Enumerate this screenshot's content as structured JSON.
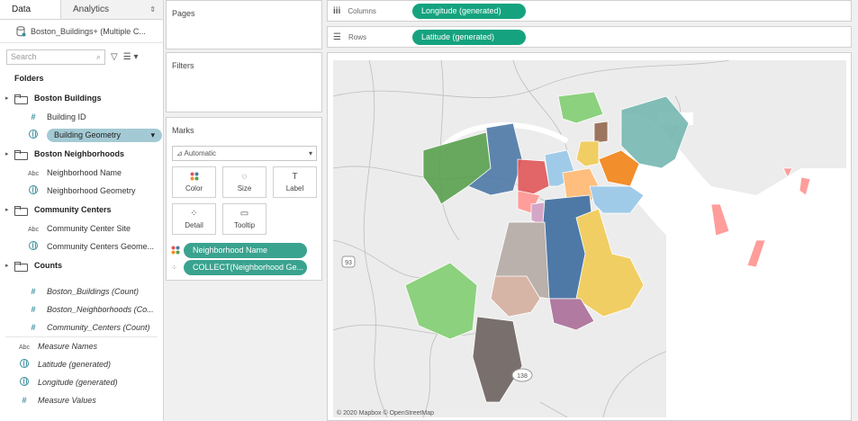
{
  "tabs": {
    "data": "Data",
    "analytics": "Analytics"
  },
  "datasource": "Boston_Buildings+ (Multiple C...",
  "search": {
    "placeholder": "Search"
  },
  "folders_label": "Folders",
  "folders": [
    {
      "name": "Boston Buildings",
      "fields": [
        {
          "type": "hash",
          "name": "Building ID"
        },
        {
          "type": "globe",
          "name": "Building Geometry",
          "selected": true
        }
      ]
    },
    {
      "name": "Boston Neighborhoods",
      "fields": [
        {
          "type": "abc",
          "name": "Neighborhood Name"
        },
        {
          "type": "globe",
          "name": "Neighborhood Geometry"
        }
      ]
    },
    {
      "name": "Community Centers",
      "fields": [
        {
          "type": "abc",
          "name": "Community Center Site"
        },
        {
          "type": "globe",
          "name": "Community Centers Geome..."
        }
      ]
    },
    {
      "name": "Counts",
      "fields": [
        {
          "type": "hash",
          "name": "Boston_Buildings (Count)"
        },
        {
          "type": "hash",
          "name": "Boston_Neighborhoods (Co..."
        },
        {
          "type": "hash",
          "name": "Community_Centers (Count)"
        }
      ]
    }
  ],
  "measures": [
    {
      "type": "abc",
      "name": "Measure Names"
    },
    {
      "type": "globe",
      "name": "Latitude (generated)"
    },
    {
      "type": "globe",
      "name": "Longitude (generated)"
    },
    {
      "type": "hash",
      "name": "Measure Values"
    }
  ],
  "cards": {
    "pages": "Pages",
    "filters": "Filters",
    "marks": "Marks"
  },
  "marks": {
    "type": "Automatic",
    "buttons": {
      "color": "Color",
      "size": "Size",
      "label": "Label",
      "detail": "Detail",
      "tooltip": "Tooltip"
    },
    "pills": [
      "Neighborhood Name",
      "COLLECT(Neighborhood Ge..."
    ]
  },
  "shelves": {
    "columns_label": "Columns",
    "columns_pill": "Longitude (generated)",
    "rows_label": "Rows",
    "rows_pill": "Latitude (generated)"
  },
  "map": {
    "attribution": "© 2020 Mapbox © OpenStreetMap",
    "shield1": "93",
    "shield2": "138"
  },
  "colors": {
    "pill": "#3aa38f",
    "shelf_pill": "#15a37f",
    "field_selected": "#a3cad4"
  }
}
